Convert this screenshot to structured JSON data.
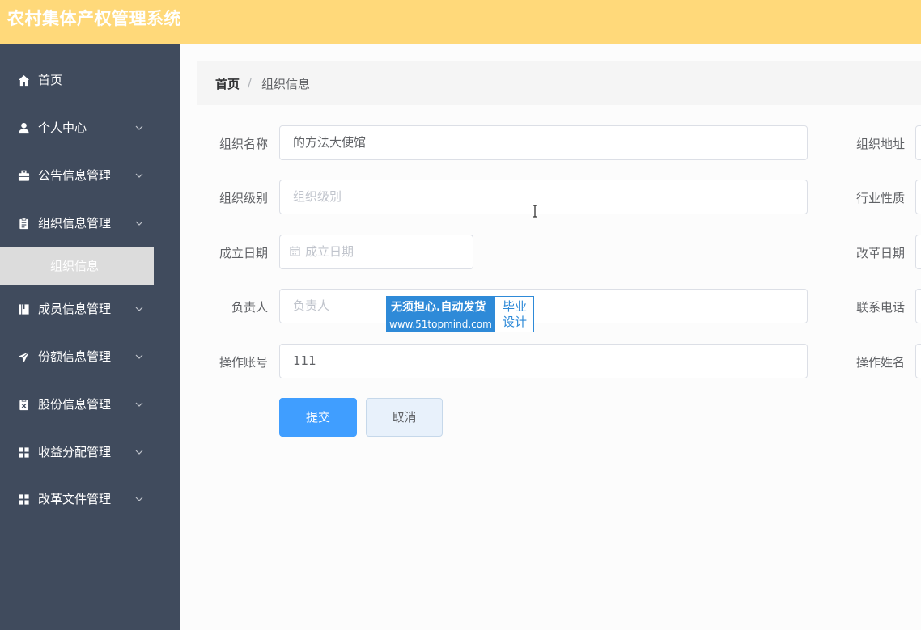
{
  "header": {
    "title": "农村集体产权管理系统"
  },
  "sidebar": {
    "items": [
      {
        "label": "首页",
        "icon": "home-icon"
      },
      {
        "label": "个人中心",
        "icon": "user-icon"
      },
      {
        "label": "公告信息管理",
        "icon": "briefcase-icon"
      },
      {
        "label": "组织信息管理",
        "icon": "clipboard-icon"
      },
      {
        "label": "成员信息管理",
        "icon": "book-icon"
      },
      {
        "label": "份额信息管理",
        "icon": "send-icon"
      },
      {
        "label": "股份信息管理",
        "icon": "clipboard-x-icon"
      },
      {
        "label": "收益分配管理",
        "icon": "grid-icon"
      },
      {
        "label": "改革文件管理",
        "icon": "grid-icon"
      }
    ],
    "active_sub": "组织信息"
  },
  "breadcrumb": {
    "home": "首页",
    "separator": "/",
    "current": "组织信息"
  },
  "form": {
    "org_name": {
      "label": "组织名称",
      "value": "的方法大使馆"
    },
    "org_address": {
      "label": "组织地址"
    },
    "org_level": {
      "label": "组织级别",
      "placeholder": "组织级别"
    },
    "industry": {
      "label": "行业性质"
    },
    "founded_date": {
      "label": "成立日期",
      "placeholder": "成立日期"
    },
    "reform_date": {
      "label": "改革日期"
    },
    "leader": {
      "label": "负责人",
      "placeholder": "负责人"
    },
    "phone": {
      "label": "联系电话"
    },
    "operator_account": {
      "label": "操作账号",
      "value": "111"
    },
    "operator_name": {
      "label": "操作姓名"
    },
    "submit_label": "提交",
    "cancel_label": "取消"
  },
  "watermark": {
    "line1": "无须担心.自动发货",
    "line2": "www.51topmind.com",
    "right_top": "毕业",
    "right_bottom": "设计"
  }
}
